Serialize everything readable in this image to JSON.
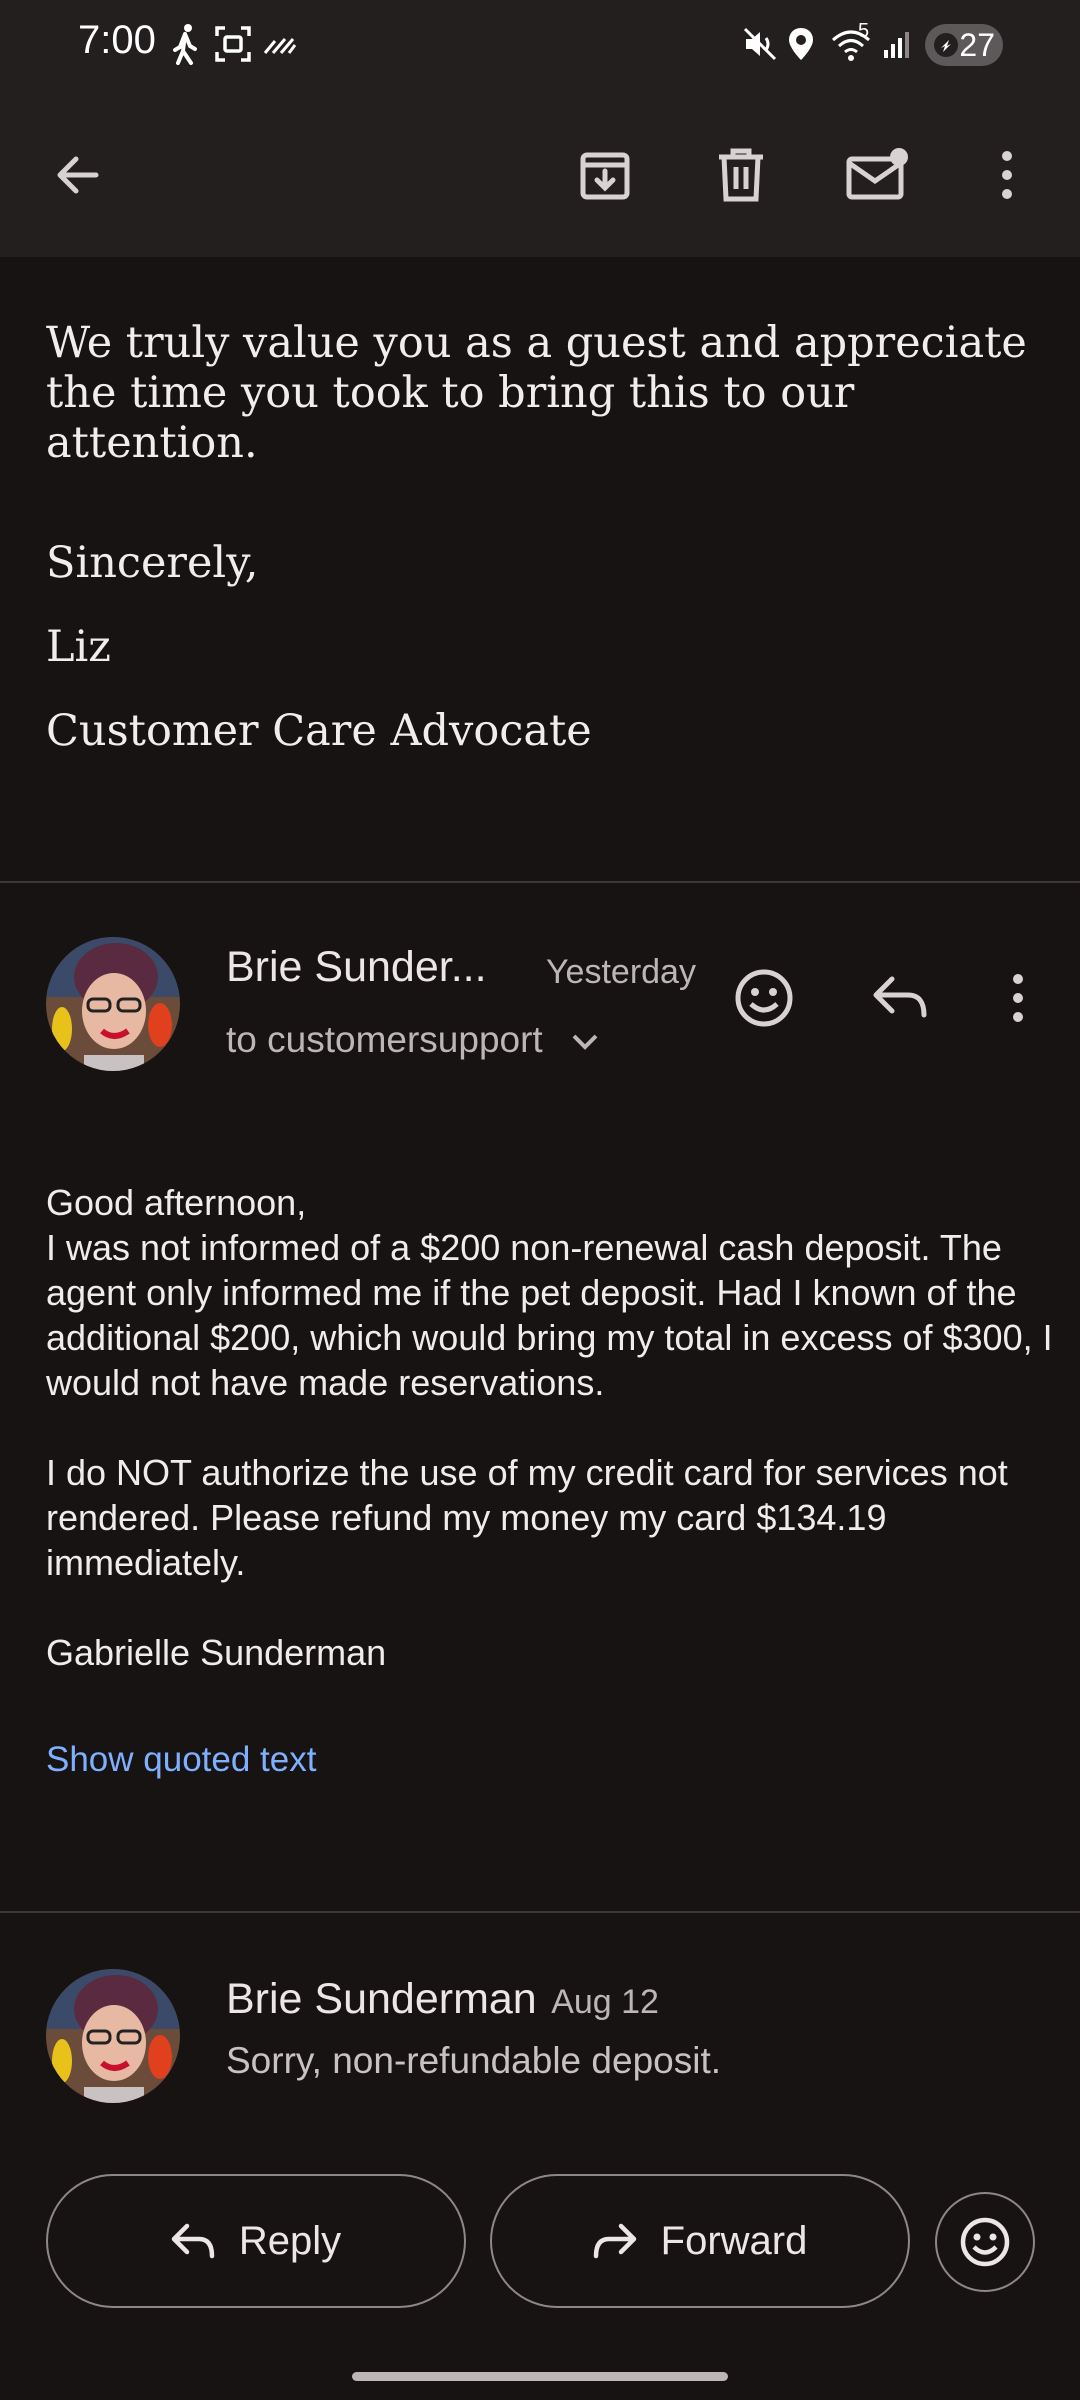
{
  "status_bar": {
    "time": "7:00",
    "wifi_label": "5",
    "battery": "27",
    "icons": [
      "walking-icon",
      "screenshot-icon",
      "signal-pattern-icon",
      "mute-icon",
      "location-icon",
      "wifi-icon",
      "cell-signal-icon",
      "battery-icon"
    ]
  },
  "toolbar": {
    "icons": [
      "back-arrow-icon",
      "archive-icon",
      "delete-icon",
      "mark-unread-icon",
      "more-vert-icon"
    ]
  },
  "previous_message": {
    "paragraph": "We truly value you as a guest and appreciate the time you took to bring this to our attention.",
    "closing": "Sincerely,",
    "name": "Liz",
    "title": "Customer Care Advocate"
  },
  "expanded_message": {
    "sender": "Brie Sunder...",
    "date": "Yesterday",
    "recipient": "to customersupport",
    "body": {
      "greeting": "Good afternoon,",
      "para1": "I was not informed of a $200 non-renewal cash deposit. The agent only informed me if the pet deposit. Had I known of the additional $200, which would bring my total in excess of $300, I would not have made reservations.",
      "para2": "I do NOT authorize the use of my credit card for services not rendered. Please refund my money my card $134.19 immediately.",
      "signature": "Gabrielle Sunderman"
    },
    "show_quoted": "Show quoted text"
  },
  "collapsed_message": {
    "sender": "Brie Sunderman",
    "date": "Aug 12",
    "snippet": "Sorry, non-refundable deposit."
  },
  "actions": {
    "reply": "Reply",
    "forward": "Forward"
  },
  "colors": {
    "background": "#181313",
    "toolbar": "#241f1f",
    "link": "#7fb0ff"
  }
}
